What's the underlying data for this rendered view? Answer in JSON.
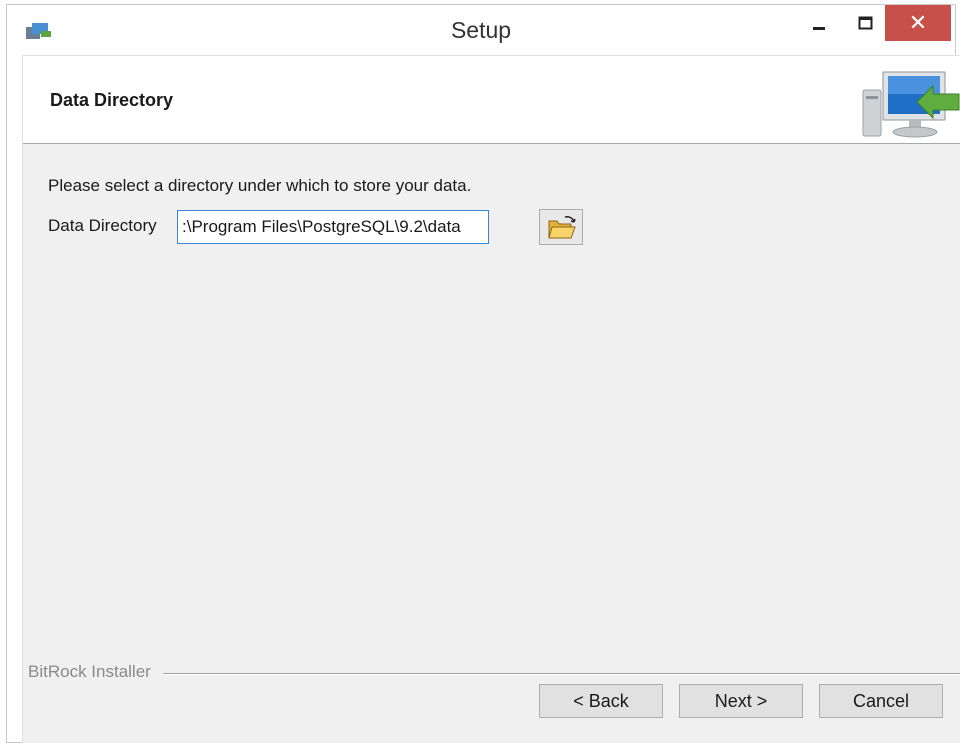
{
  "window": {
    "title": "Setup",
    "controls": {
      "minimize": "–",
      "maximize": "□",
      "close": "✕"
    }
  },
  "header": {
    "title": "Data Directory",
    "graphic_icon": "computer-install-icon"
  },
  "main": {
    "prompt": "Please select a directory under which to store your data.",
    "data_directory": {
      "label": "Data Directory",
      "value": ":\\Program Files\\PostgreSQL\\9.2\\data"
    },
    "browse_icon": "open-folder-icon"
  },
  "footer": {
    "brand": "BitRock Installer",
    "buttons": {
      "back": "< Back",
      "next": "Next >",
      "cancel": "Cancel"
    }
  },
  "colors": {
    "close_button": "#c7504b",
    "focus_border": "#3a86d6",
    "dialog_bg": "#f0f0f0"
  }
}
